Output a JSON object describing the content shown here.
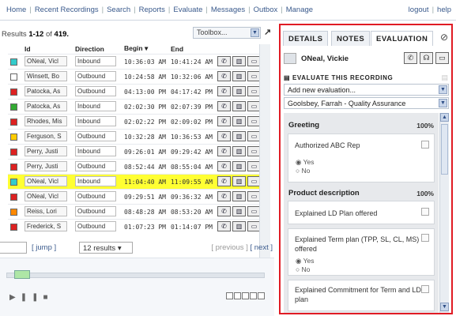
{
  "nav": {
    "items": [
      "Home",
      "Recent Recordings",
      "Search",
      "Reports",
      "Evaluate",
      "Messages",
      "Outbox",
      "Manage"
    ],
    "logout": "logout",
    "help": "help"
  },
  "results": {
    "label_prefix": "Results ",
    "range": "1-12",
    "of_label": " of ",
    "total": "419.",
    "toolbox_label": "Toolbox...",
    "columns": [
      "Id",
      "Direction",
      "Begin ▾",
      "End"
    ],
    "rows": [
      {
        "color": "#33cccc",
        "name": "ONeal, Vicl",
        "direction": "Inbound",
        "begin": "10:36:03 AM",
        "end": "10:41:24 AM",
        "highlight": false
      },
      {
        "color": "#ffffff",
        "name": "Winsett, Bo",
        "direction": "Outbound",
        "begin": "10:24:58 AM",
        "end": "10:32:06 AM",
        "highlight": false
      },
      {
        "color": "#dd2222",
        "name": "Patocka, As",
        "direction": "Outbound",
        "begin": "04:13:00 PM",
        "end": "04:17:42 PM",
        "highlight": false
      },
      {
        "color": "#33aa33",
        "name": "Patocka, As",
        "direction": "Inbound",
        "begin": "02:02:30 PM",
        "end": "02:07:39 PM",
        "highlight": false
      },
      {
        "color": "#dd2222",
        "name": "Rhodes, Mis",
        "direction": "Inbound",
        "begin": "02:02:22 PM",
        "end": "02:09:02 PM",
        "highlight": false
      },
      {
        "color": "#ffcc00",
        "name": "Ferguson, S",
        "direction": "Outbound",
        "begin": "10:32:28 AM",
        "end": "10:36:53 AM",
        "highlight": false
      },
      {
        "color": "#dd2222",
        "name": "Perry, Justi",
        "direction": "Inbound",
        "begin": "09:26:01 AM",
        "end": "09:29:42 AM",
        "highlight": false
      },
      {
        "color": "#dd2222",
        "name": "Perry, Justi",
        "direction": "Outbound",
        "begin": "08:52:44 AM",
        "end": "08:55:04 AM",
        "highlight": false
      },
      {
        "color": "#33cccc",
        "name": "ONeal, Vicl",
        "direction": "Inbound",
        "begin": "11:04:40 AM",
        "end": "11:09:55 AM",
        "highlight": true
      },
      {
        "color": "#dd2222",
        "name": "ONeal, Vicl",
        "direction": "Outbound",
        "begin": "09:29:51 AM",
        "end": "09:36:32 AM",
        "highlight": false
      },
      {
        "color": "#ff8800",
        "name": "Reiss, Lori",
        "direction": "Outbound",
        "begin": "08:48:28 AM",
        "end": "08:53:20 AM",
        "highlight": false
      },
      {
        "color": "#dd2222",
        "name": "Frederick, S",
        "direction": "Outbound",
        "begin": "01:07:23 PM",
        "end": "01:14:07 PM",
        "highlight": false
      }
    ],
    "jump_label": "[ jump ]",
    "per_page_label": "12 results",
    "previous_label": "[ previous ]",
    "next_label": "[ next ]"
  },
  "player": {
    "progress": 0.03
  },
  "details": {
    "tabs": [
      "DETAILS",
      "NOTES",
      "EVALUATION"
    ],
    "active_tab": "EVALUATION",
    "agent_name": "ONeal, Vickie",
    "evaluate_heading": "EVALUATE THIS RECORDING",
    "add_select": "Add new evaluation...",
    "evaluator_select": "Goolsbey, Farrah - Quality Assurance",
    "sections": [
      {
        "title": "Greeting",
        "percent": "100%"
      },
      {
        "title": "Product description",
        "percent": "100%"
      }
    ],
    "questions": [
      {
        "text": "Authorized ABC Rep",
        "yes": "Yes",
        "no": "No"
      },
      {
        "text": "Explained LD Plan offered"
      },
      {
        "text": "Explained Term plan (TPP, SL, CL, MS) offered",
        "yes": "Yes",
        "no": "No"
      },
      {
        "text": "Explained Commitment for Term and LD plan"
      }
    ]
  },
  "colors": {
    "highlight": "#ffff33",
    "panel_border": "#e01b24",
    "link": "#3a5a8c"
  }
}
